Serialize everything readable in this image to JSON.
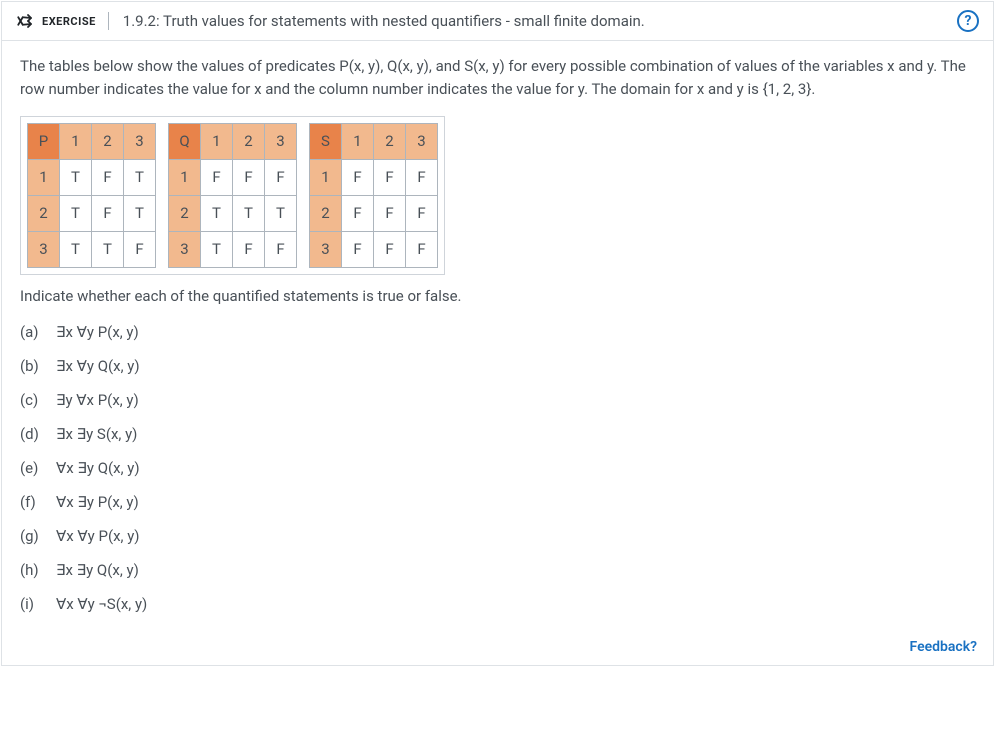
{
  "header": {
    "badge": "EXERCISE",
    "title": "1.9.2: Truth values for statements with nested quantifiers - small finite domain."
  },
  "intro": "The tables below show the values of predicates P(x, y), Q(x, y), and S(x, y) for every possible combination of values of the variables x and y. The row number indicates the value for x and the column number indicates the value for y. The domain for x and y is {1, 2, 3}.",
  "tables": [
    {
      "name": "P",
      "cols": [
        "1",
        "2",
        "3"
      ],
      "rows": [
        {
          "h": "1",
          "cells": [
            "T",
            "F",
            "T"
          ]
        },
        {
          "h": "2",
          "cells": [
            "T",
            "F",
            "T"
          ]
        },
        {
          "h": "3",
          "cells": [
            "T",
            "T",
            "F"
          ]
        }
      ]
    },
    {
      "name": "Q",
      "cols": [
        "1",
        "2",
        "3"
      ],
      "rows": [
        {
          "h": "1",
          "cells": [
            "F",
            "F",
            "F"
          ]
        },
        {
          "h": "2",
          "cells": [
            "T",
            "T",
            "T"
          ]
        },
        {
          "h": "3",
          "cells": [
            "T",
            "F",
            "F"
          ]
        }
      ]
    },
    {
      "name": "S",
      "cols": [
        "1",
        "2",
        "3"
      ],
      "rows": [
        {
          "h": "1",
          "cells": [
            "F",
            "F",
            "F"
          ]
        },
        {
          "h": "2",
          "cells": [
            "F",
            "F",
            "F"
          ]
        },
        {
          "h": "3",
          "cells": [
            "F",
            "F",
            "F"
          ]
        }
      ]
    }
  ],
  "prompt": "Indicate whether each of the quantified statements is true or false.",
  "questions": [
    {
      "label": "(a)",
      "text": "∃x ∀y P(x, y)"
    },
    {
      "label": "(b)",
      "text": "∃x ∀y Q(x, y)"
    },
    {
      "label": "(c)",
      "text": "∃y ∀x P(x, y)"
    },
    {
      "label": "(d)",
      "text": "∃x ∃y S(x, y)"
    },
    {
      "label": "(e)",
      "text": "∀x ∃y Q(x, y)"
    },
    {
      "label": "(f)",
      "text": "∀x ∃y P(x, y)"
    },
    {
      "label": "(g)",
      "text": "∀x ∀y P(x, y)"
    },
    {
      "label": "(h)",
      "text": "∃x ∃y Q(x, y)"
    },
    {
      "label": "(i)",
      "text": "∀x ∀y ¬S(x, y)"
    }
  ],
  "feedback": "Feedback?"
}
